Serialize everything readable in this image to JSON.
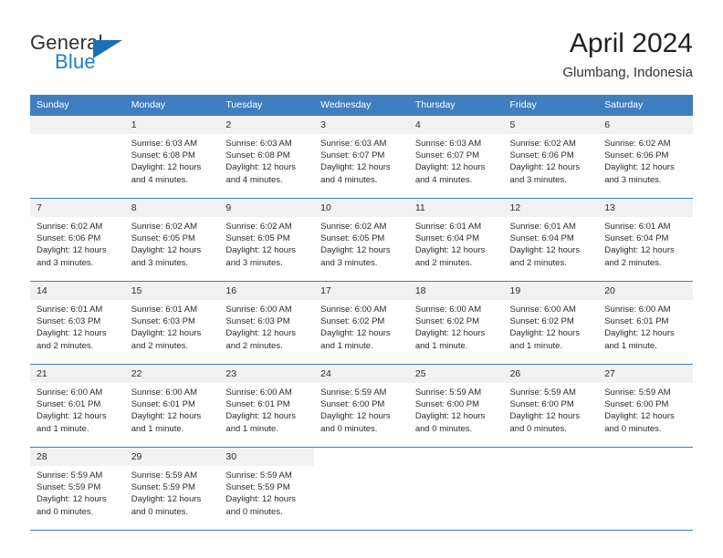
{
  "brand": {
    "line1": "General",
    "line2": "Blue",
    "logo_icon": "triangle-logo-icon",
    "accent_color": "#1b6fb5"
  },
  "header": {
    "month_title": "April 2024",
    "location": "Glumbang, Indonesia"
  },
  "calendar": {
    "header_bg": "#3f7fbf",
    "daynum_bg": "#f1f1f1",
    "weekday_headers": [
      "Sunday",
      "Monday",
      "Tuesday",
      "Wednesday",
      "Thursday",
      "Friday",
      "Saturday"
    ],
    "weeks": [
      [
        {
          "day": "",
          "sunrise": "",
          "sunset": "",
          "daylight_line1": "",
          "daylight_line2": ""
        },
        {
          "day": "1",
          "sunrise": "Sunrise: 6:03 AM",
          "sunset": "Sunset: 6:08 PM",
          "daylight_line1": "Daylight: 12 hours",
          "daylight_line2": "and 4 minutes."
        },
        {
          "day": "2",
          "sunrise": "Sunrise: 6:03 AM",
          "sunset": "Sunset: 6:08 PM",
          "daylight_line1": "Daylight: 12 hours",
          "daylight_line2": "and 4 minutes."
        },
        {
          "day": "3",
          "sunrise": "Sunrise: 6:03 AM",
          "sunset": "Sunset: 6:07 PM",
          "daylight_line1": "Daylight: 12 hours",
          "daylight_line2": "and 4 minutes."
        },
        {
          "day": "4",
          "sunrise": "Sunrise: 6:03 AM",
          "sunset": "Sunset: 6:07 PM",
          "daylight_line1": "Daylight: 12 hours",
          "daylight_line2": "and 4 minutes."
        },
        {
          "day": "5",
          "sunrise": "Sunrise: 6:02 AM",
          "sunset": "Sunset: 6:06 PM",
          "daylight_line1": "Daylight: 12 hours",
          "daylight_line2": "and 3 minutes."
        },
        {
          "day": "6",
          "sunrise": "Sunrise: 6:02 AM",
          "sunset": "Sunset: 6:06 PM",
          "daylight_line1": "Daylight: 12 hours",
          "daylight_line2": "and 3 minutes."
        }
      ],
      [
        {
          "day": "7",
          "sunrise": "Sunrise: 6:02 AM",
          "sunset": "Sunset: 6:06 PM",
          "daylight_line1": "Daylight: 12 hours",
          "daylight_line2": "and 3 minutes."
        },
        {
          "day": "8",
          "sunrise": "Sunrise: 6:02 AM",
          "sunset": "Sunset: 6:05 PM",
          "daylight_line1": "Daylight: 12 hours",
          "daylight_line2": "and 3 minutes."
        },
        {
          "day": "9",
          "sunrise": "Sunrise: 6:02 AM",
          "sunset": "Sunset: 6:05 PM",
          "daylight_line1": "Daylight: 12 hours",
          "daylight_line2": "and 3 minutes."
        },
        {
          "day": "10",
          "sunrise": "Sunrise: 6:02 AM",
          "sunset": "Sunset: 6:05 PM",
          "daylight_line1": "Daylight: 12 hours",
          "daylight_line2": "and 3 minutes."
        },
        {
          "day": "11",
          "sunrise": "Sunrise: 6:01 AM",
          "sunset": "Sunset: 6:04 PM",
          "daylight_line1": "Daylight: 12 hours",
          "daylight_line2": "and 2 minutes."
        },
        {
          "day": "12",
          "sunrise": "Sunrise: 6:01 AM",
          "sunset": "Sunset: 6:04 PM",
          "daylight_line1": "Daylight: 12 hours",
          "daylight_line2": "and 2 minutes."
        },
        {
          "day": "13",
          "sunrise": "Sunrise: 6:01 AM",
          "sunset": "Sunset: 6:04 PM",
          "daylight_line1": "Daylight: 12 hours",
          "daylight_line2": "and 2 minutes."
        }
      ],
      [
        {
          "day": "14",
          "sunrise": "Sunrise: 6:01 AM",
          "sunset": "Sunset: 6:03 PM",
          "daylight_line1": "Daylight: 12 hours",
          "daylight_line2": "and 2 minutes."
        },
        {
          "day": "15",
          "sunrise": "Sunrise: 6:01 AM",
          "sunset": "Sunset: 6:03 PM",
          "daylight_line1": "Daylight: 12 hours",
          "daylight_line2": "and 2 minutes."
        },
        {
          "day": "16",
          "sunrise": "Sunrise: 6:00 AM",
          "sunset": "Sunset: 6:03 PM",
          "daylight_line1": "Daylight: 12 hours",
          "daylight_line2": "and 2 minutes."
        },
        {
          "day": "17",
          "sunrise": "Sunrise: 6:00 AM",
          "sunset": "Sunset: 6:02 PM",
          "daylight_line1": "Daylight: 12 hours",
          "daylight_line2": "and 1 minute."
        },
        {
          "day": "18",
          "sunrise": "Sunrise: 6:00 AM",
          "sunset": "Sunset: 6:02 PM",
          "daylight_line1": "Daylight: 12 hours",
          "daylight_line2": "and 1 minute."
        },
        {
          "day": "19",
          "sunrise": "Sunrise: 6:00 AM",
          "sunset": "Sunset: 6:02 PM",
          "daylight_line1": "Daylight: 12 hours",
          "daylight_line2": "and 1 minute."
        },
        {
          "day": "20",
          "sunrise": "Sunrise: 6:00 AM",
          "sunset": "Sunset: 6:01 PM",
          "daylight_line1": "Daylight: 12 hours",
          "daylight_line2": "and 1 minute."
        }
      ],
      [
        {
          "day": "21",
          "sunrise": "Sunrise: 6:00 AM",
          "sunset": "Sunset: 6:01 PM",
          "daylight_line1": "Daylight: 12 hours",
          "daylight_line2": "and 1 minute."
        },
        {
          "day": "22",
          "sunrise": "Sunrise: 6:00 AM",
          "sunset": "Sunset: 6:01 PM",
          "daylight_line1": "Daylight: 12 hours",
          "daylight_line2": "and 1 minute."
        },
        {
          "day": "23",
          "sunrise": "Sunrise: 6:00 AM",
          "sunset": "Sunset: 6:01 PM",
          "daylight_line1": "Daylight: 12 hours",
          "daylight_line2": "and 1 minute."
        },
        {
          "day": "24",
          "sunrise": "Sunrise: 5:59 AM",
          "sunset": "Sunset: 6:00 PM",
          "daylight_line1": "Daylight: 12 hours",
          "daylight_line2": "and 0 minutes."
        },
        {
          "day": "25",
          "sunrise": "Sunrise: 5:59 AM",
          "sunset": "Sunset: 6:00 PM",
          "daylight_line1": "Daylight: 12 hours",
          "daylight_line2": "and 0 minutes."
        },
        {
          "day": "26",
          "sunrise": "Sunrise: 5:59 AM",
          "sunset": "Sunset: 6:00 PM",
          "daylight_line1": "Daylight: 12 hours",
          "daylight_line2": "and 0 minutes."
        },
        {
          "day": "27",
          "sunrise": "Sunrise: 5:59 AM",
          "sunset": "Sunset: 6:00 PM",
          "daylight_line1": "Daylight: 12 hours",
          "daylight_line2": "and 0 minutes."
        }
      ],
      [
        {
          "day": "28",
          "sunrise": "Sunrise: 5:59 AM",
          "sunset": "Sunset: 5:59 PM",
          "daylight_line1": "Daylight: 12 hours",
          "daylight_line2": "and 0 minutes."
        },
        {
          "day": "29",
          "sunrise": "Sunrise: 5:59 AM",
          "sunset": "Sunset: 5:59 PM",
          "daylight_line1": "Daylight: 12 hours",
          "daylight_line2": "and 0 minutes."
        },
        {
          "day": "30",
          "sunrise": "Sunrise: 5:59 AM",
          "sunset": "Sunset: 5:59 PM",
          "daylight_line1": "Daylight: 12 hours",
          "daylight_line2": "and 0 minutes."
        },
        {
          "day": "",
          "sunrise": "",
          "sunset": "",
          "daylight_line1": "",
          "daylight_line2": ""
        },
        {
          "day": "",
          "sunrise": "",
          "sunset": "",
          "daylight_line1": "",
          "daylight_line2": ""
        },
        {
          "day": "",
          "sunrise": "",
          "sunset": "",
          "daylight_line1": "",
          "daylight_line2": ""
        },
        {
          "day": "",
          "sunrise": "",
          "sunset": "",
          "daylight_line1": "",
          "daylight_line2": ""
        }
      ]
    ]
  }
}
